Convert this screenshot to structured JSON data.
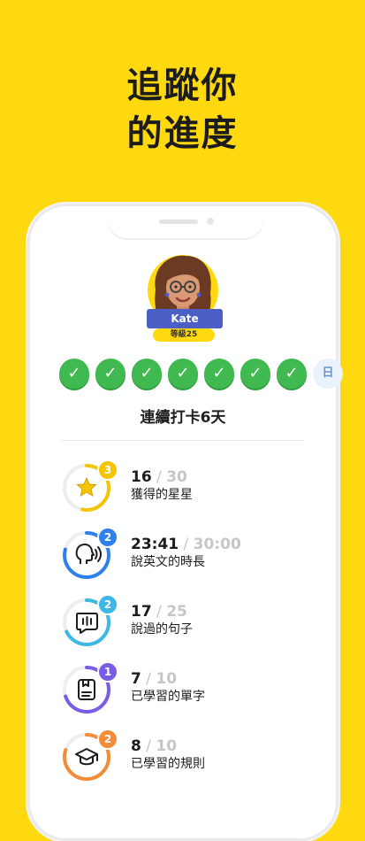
{
  "headline": {
    "line1": "追蹤你",
    "line2": "的進度"
  },
  "profile": {
    "name": "Kate",
    "level": "等級25"
  },
  "streak": {
    "completed_days": 7,
    "next_day_label": "日",
    "label": "連續打卡6天"
  },
  "stats": [
    {
      "value": "16",
      "total": "30",
      "label": "獲得的星星",
      "badge": "3",
      "color": "#F5C400",
      "progress": 0.53,
      "icon": "star-icon"
    },
    {
      "value": "23:41",
      "total": "30:00",
      "label": "說英文的時長",
      "badge": "2",
      "color": "#2F80ED",
      "progress": 0.79,
      "icon": "speaking-head-icon"
    },
    {
      "value": "17",
      "total": "25",
      "label": "說過的句子",
      "badge": "2",
      "color": "#3DB7E4",
      "progress": 0.68,
      "icon": "chat-bubble-icon"
    },
    {
      "value": "7",
      "total": "10",
      "label": "已學習的單字",
      "badge": "1",
      "color": "#7B5CE6",
      "progress": 0.7,
      "icon": "flashcard-icon"
    },
    {
      "value": "8",
      "total": "10",
      "label": "已學習的規則",
      "badge": "2",
      "color": "#F28C38",
      "progress": 0.8,
      "icon": "graduation-cap-icon"
    }
  ]
}
